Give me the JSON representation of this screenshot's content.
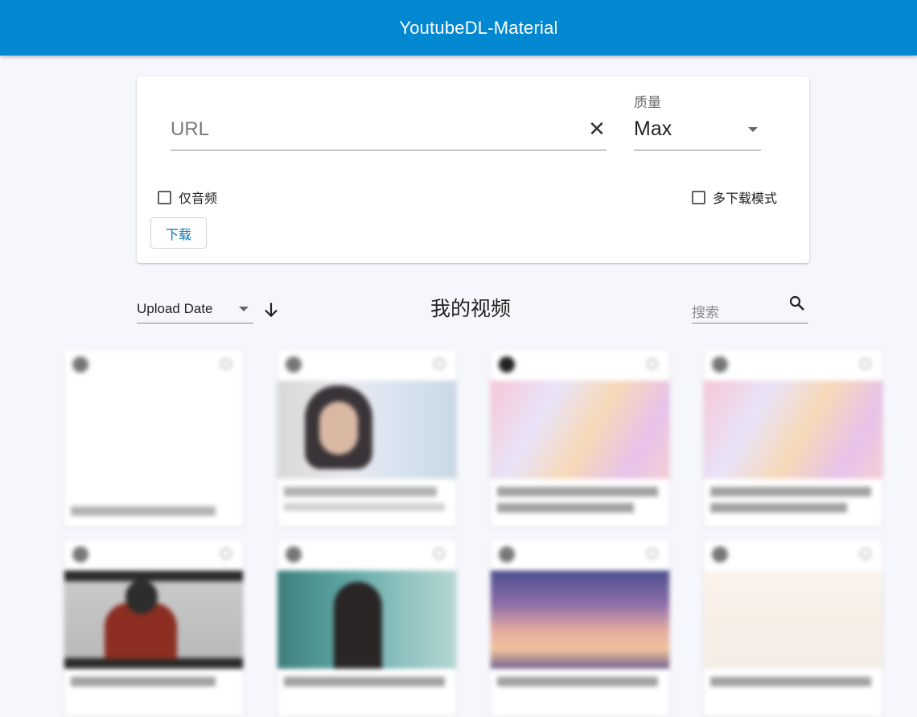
{
  "app": {
    "title": "YoutubeDL-Material"
  },
  "download_card": {
    "url_placeholder": "URL",
    "clear_icon": "close-icon",
    "quality_label": "质量",
    "quality_value": "Max",
    "audio_only_label": "仅音频",
    "multi_download_label": "多下载模式",
    "download_button": "下载"
  },
  "videos_section": {
    "sort_value": "Upload Date",
    "sort_direction_icon": "arrow-down-icon",
    "title": "我的视频",
    "search_placeholder": "搜索",
    "search_icon": "search-icon"
  },
  "colors": {
    "primary": "#0288d1",
    "background": "#f6f7fc",
    "button_text": "#0277bd"
  }
}
